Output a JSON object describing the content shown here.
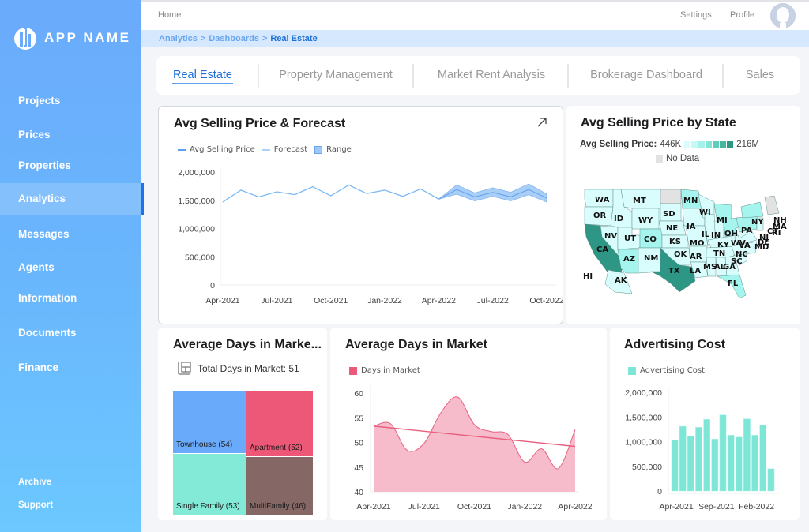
{
  "app": {
    "name": "APP NAME"
  },
  "sidebar": {
    "items": [
      {
        "label": "Projects"
      },
      {
        "label": "Prices"
      },
      {
        "label": "Properties"
      },
      {
        "label": "Analytics",
        "active": true
      },
      {
        "label": "Messages"
      },
      {
        "label": "Agents"
      },
      {
        "label": "Information"
      },
      {
        "label": "Documents"
      },
      {
        "label": "Finance"
      }
    ],
    "footer": [
      {
        "label": "Archive"
      },
      {
        "label": "Support"
      }
    ]
  },
  "topbar": {
    "home": "Home",
    "settings": "Settings",
    "profile": "Profile"
  },
  "breadcrumb": {
    "items": [
      "Analytics",
      "Dashboards"
    ],
    "current": "Real Estate",
    "separator": ">"
  },
  "tabs": [
    {
      "label": "Real Estate",
      "active": true
    },
    {
      "label": "Property Management"
    },
    {
      "label": "Market Rent Analysis"
    },
    {
      "label": "Brokerage Dashboard"
    },
    {
      "label": "Sales"
    }
  ],
  "colors": {
    "accent": "#1f6fd6",
    "line": "#7ab8f5",
    "range": "#9cc7f6",
    "area": "#f7bccb",
    "area_line": "#e8607e",
    "bar": "#7ee6d6",
    "map_low": "#d9fdfd",
    "map_high": "#2e9684",
    "no_data": "#e2e2e2"
  },
  "cards": {
    "forecast": {
      "title": "Avg Selling Price & Forecast",
      "legend": [
        "Avg Selling Price",
        "Forecast",
        "Range"
      ]
    },
    "map": {
      "title": "Avg Selling Price by State",
      "legend_label": "Avg Selling Price:",
      "legend_min": "446K",
      "legend_max": "216M",
      "no_data": "No Data",
      "states": [
        "WA",
        "MT",
        "MN",
        "OR",
        "ID",
        "WY",
        "SD",
        "WI",
        "MI",
        "NY",
        "NH",
        "MA",
        "RI",
        "CT",
        "NJ",
        "DE",
        "MD",
        "IA",
        "NE",
        "IL",
        "IN",
        "OH",
        "PA",
        "NV",
        "UT",
        "CO",
        "KS",
        "MO",
        "KY",
        "WV",
        "VA",
        "CA",
        "AZ",
        "NM",
        "OK",
        "AR",
        "TN",
        "NC",
        "SC",
        "MS",
        "AL",
        "GA",
        "LA",
        "TX",
        "FL",
        "HI",
        "AK"
      ]
    },
    "treemap": {
      "title": "Average Days in Marke...",
      "summary": "Total Days in Market: 51"
    },
    "days": {
      "title": "Average Days in Market",
      "legend": "Days in Market"
    },
    "advertising": {
      "title": "Advertising Cost",
      "legend": "Advertising Cost"
    }
  },
  "chart_data": [
    {
      "id": "forecast",
      "type": "line",
      "title": "Avg Selling Price & Forecast",
      "x_ticks": [
        "Apr-2021",
        "Jul-2021",
        "Oct-2021",
        "Jan-2022",
        "Apr-2022",
        "Jul-2022",
        "Oct-2022"
      ],
      "y_ticks": [
        "0",
        "500,000",
        "1,000,000",
        "1,500,000",
        "2,000,000"
      ],
      "ylim": [
        0,
        2000000
      ],
      "x_months": 19,
      "series": [
        {
          "name": "Avg Selling Price",
          "start": 0,
          "values": [
            1470000,
            1680000,
            1560000,
            1650000,
            1600000,
            1740000,
            1580000,
            1770000,
            1620000,
            1680000,
            1570000,
            1700000,
            1520000
          ]
        },
        {
          "name": "Forecast",
          "start": 12,
          "values": [
            1520000,
            1690000,
            1560000,
            1640000,
            1560000,
            1690000,
            1540000
          ]
        },
        {
          "name": "Range",
          "start": 12,
          "low": [
            1520000,
            1610000,
            1490000,
            1570000,
            1490000,
            1600000,
            1470000
          ],
          "high": [
            1520000,
            1770000,
            1630000,
            1720000,
            1640000,
            1790000,
            1610000
          ]
        }
      ],
      "legend": "top-left",
      "grid": false
    },
    {
      "id": "treemap",
      "type": "treemap",
      "title": "Average Days in Market",
      "items": [
        {
          "label": "Townhouse",
          "value": 54,
          "color": "#69aafb"
        },
        {
          "label": "Apartment",
          "value": 52,
          "color": "#ee5878"
        },
        {
          "label": "Single Family",
          "value": 53,
          "color": "#84ead8"
        },
        {
          "label": "MultiFamily",
          "value": 46,
          "color": "#856766"
        }
      ]
    },
    {
      "id": "days",
      "type": "area",
      "title": "Average Days in Market",
      "x_ticks": [
        "Apr-2021",
        "Jul-2021",
        "Oct-2021",
        "Jan-2022",
        "Apr-2022"
      ],
      "y_ticks": [
        "40",
        "45",
        "50",
        "55",
        "60"
      ],
      "ylim": [
        40,
        60
      ],
      "x": [
        "Apr-2021",
        "May-2021",
        "Jun-2021",
        "Jul-2021",
        "Aug-2021",
        "Sep-2021",
        "Oct-2021",
        "Nov-2021",
        "Dec-2021",
        "Jan-2022",
        "Feb-2022",
        "Mar-2022",
        "Apr-2022"
      ],
      "values": [
        53.3,
        53.8,
        48.4,
        49.8,
        56.0,
        59.2,
        53.6,
        52.2,
        51.6,
        46.0,
        48.7,
        44.7,
        52.6
      ],
      "trend": [
        53.3,
        49.2
      ],
      "legend": "top-left"
    },
    {
      "id": "advertising",
      "type": "bar",
      "title": "Advertising Cost",
      "x_ticks": [
        "Apr-2021",
        "Sep-2021",
        "Feb-2022"
      ],
      "categories": [
        "Apr-2021",
        "May-2021",
        "Jun-2021",
        "Jul-2021",
        "Aug-2021",
        "Sep-2021",
        "Oct-2021",
        "Nov-2021",
        "Dec-2021",
        "Jan-2022",
        "Feb-2022",
        "Mar-2022",
        "Apr-2022"
      ],
      "values": [
        1030000,
        1310000,
        1110000,
        1290000,
        1450000,
        1050000,
        1540000,
        1130000,
        1090000,
        1460000,
        1130000,
        1330000,
        450000
      ],
      "y_ticks": [
        "0",
        "500,000",
        "1,000,000",
        "1,500,000",
        "2,000,000"
      ],
      "ylim": [
        0,
        2000000
      ],
      "legend": "top-left"
    }
  ]
}
